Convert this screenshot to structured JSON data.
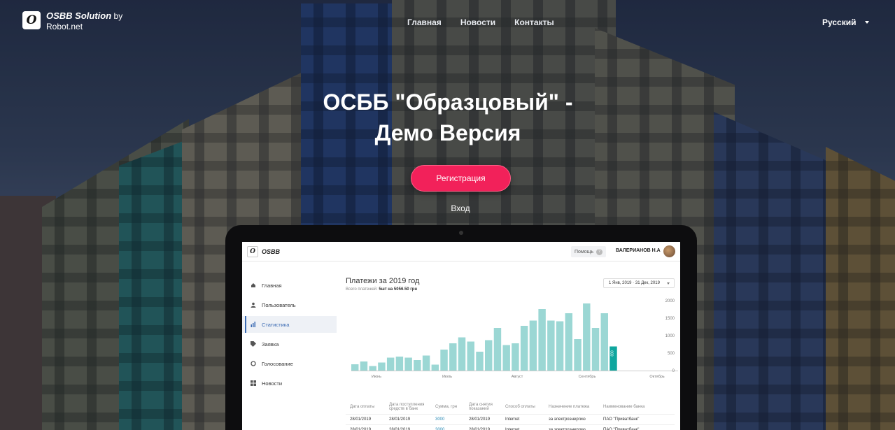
{
  "header": {
    "brand": "OSBB Solution",
    "brand_by": "by",
    "brand_sub": "Robot.net",
    "logo_letter": "O",
    "nav": [
      "Главная",
      "Новости",
      "Контакты"
    ],
    "language": "Русский"
  },
  "hero": {
    "title_line1": "ОСББ \"Образцовый\" -",
    "title_line2": "Демо Версия",
    "register_label": "Регистрация",
    "login_label": "Вход",
    "accent_color": "#f2215a"
  },
  "app": {
    "logo_letter": "O",
    "logo_text": "OSBB",
    "help_label": "Помощь",
    "help_icon": "?",
    "user_name": "ВАЛЕРИАНОВ Н.А",
    "sidebar": [
      {
        "label": "Главная",
        "icon": "home-icon"
      },
      {
        "label": "Пользователь",
        "icon": "user-icon"
      },
      {
        "label": "Статистика",
        "icon": "stats-icon",
        "active": true
      },
      {
        "label": "Заявка",
        "icon": "tag-icon"
      },
      {
        "label": "Голосование",
        "icon": "circle-icon"
      },
      {
        "label": "Новости",
        "icon": "grid-icon"
      }
    ],
    "chart_title": "Платежи за 2019 год",
    "chart_sub_prefix": "Всего платежей:",
    "chart_sub_value": "5шт на 5056.50 грн",
    "date_range": "1 Янв, 2019 · 31 Дек, 2019",
    "table_headers": [
      "Дата оплаты",
      "Дата поступления средств в банк",
      "Сумма, грн",
      "Дата снятия показаний",
      "Способ оплаты",
      "Назначение платежа",
      "Наименование банка"
    ],
    "table_rows": [
      [
        "28/01/2019",
        "28/01/2019",
        "3000",
        "28/01/2019",
        "Internet",
        "за электроэнергию",
        "ПАО \"Приватбанк\""
      ],
      [
        "28/01/2019",
        "28/01/2019",
        "3000",
        "28/01/2019",
        "Internet",
        "за электроэнергию",
        "ПАО \"Приватбанк\""
      ]
    ]
  },
  "chart_data": {
    "type": "bar",
    "title": "Платежи за 2019 год",
    "x_tick_labels": [
      "Июнь",
      "Июль",
      "Август",
      "Сентябрь",
      "Октябрь"
    ],
    "y_ticks": [
      0,
      500,
      1000,
      1500,
      2000
    ],
    "ylim": [
      0,
      2000
    ],
    "values": [
      180,
      260,
      130,
      230,
      370,
      400,
      370,
      300,
      430,
      170,
      600,
      780,
      950,
      830,
      540,
      870,
      1220,
      730,
      780,
      1280,
      1430,
      1760,
      1430,
      1410,
      1640,
      900,
      1920,
      1220,
      1640,
      690
    ],
    "highlight_index": 29,
    "highlight_label": "690",
    "bar_color": "#9bd7d4",
    "highlight_color": "#0fa69e"
  }
}
